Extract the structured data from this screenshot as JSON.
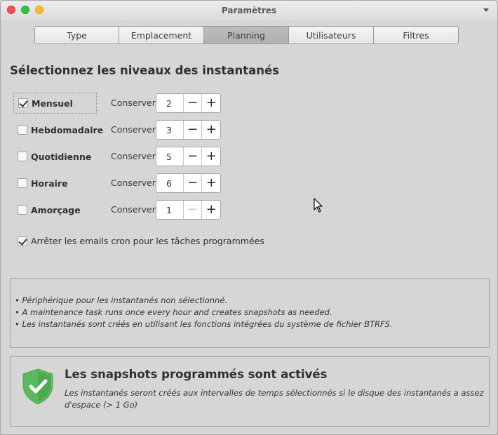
{
  "window": {
    "title": "Paramètres"
  },
  "tabs": [
    {
      "label": "Type",
      "active": false
    },
    {
      "label": "Emplacement",
      "active": false
    },
    {
      "label": "Planning",
      "active": true
    },
    {
      "label": "Utilisateurs",
      "active": false
    },
    {
      "label": "Filtres",
      "active": false
    }
  ],
  "section_title": "Sélectionnez les niveaux des instantanés",
  "levels": [
    {
      "label": "Mensuel",
      "checked": true,
      "keep_label": "Conserver",
      "value": "2"
    },
    {
      "label": "Hebdomadaire",
      "checked": false,
      "keep_label": "Conserver",
      "value": "3"
    },
    {
      "label": "Quotidienne",
      "checked": false,
      "keep_label": "Conserver",
      "value": "5"
    },
    {
      "label": "Horaire",
      "checked": false,
      "keep_label": "Conserver",
      "value": "6"
    },
    {
      "label": "Amorçage",
      "checked": false,
      "keep_label": "Conserver",
      "value": "1"
    }
  ],
  "cron_option": {
    "label": "Arrêter les emails cron pour les tâches programmées",
    "checked": true
  },
  "info_lines": [
    "• Périphérique pour les instantanés non sélectionné.",
    "• A maintenance task runs once every hour and creates snapshots as needed.",
    "• Les instantanés sont créés en utilisant les fonctions intégrées du système de fichier BTRFS."
  ],
  "status": {
    "title": "Les snapshots programmés sont activés",
    "description": "Les instantanés seront créés aux intervalles de temps sélectionnés si le disque des instantanés a assez d'espace (> 1 Go)"
  },
  "icons": {
    "shield": "shield-check-icon",
    "shield_color": "#5cb85c",
    "minus": "−",
    "plus": "+"
  }
}
